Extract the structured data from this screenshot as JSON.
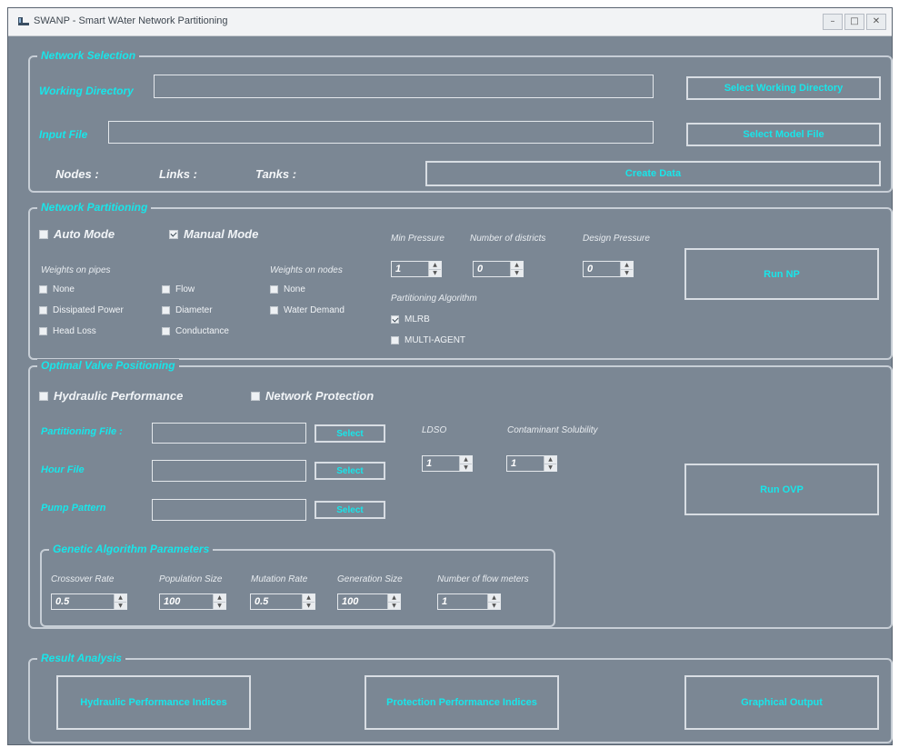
{
  "window": {
    "title": "SWANP - Smart WAter Network Partitioning",
    "controls": [
      "–",
      "□",
      "✕"
    ]
  },
  "network_selection": {
    "legend": "Network Selection",
    "working_dir_label": "Working Directory",
    "working_dir_value": "",
    "input_file_label": "Input File",
    "input_file_value": "",
    "select_working_dir_button": "Select Working Directory",
    "select_model_file_button": "Select Model File",
    "nodes_label": "Nodes :",
    "links_label": "Links :",
    "tanks_label": "Tanks :",
    "create_data_button": "Create Data"
  },
  "network_partitioning": {
    "legend": "Network Partitioning",
    "auto_mode": {
      "label": "Auto Mode",
      "checked": false
    },
    "manual_mode": {
      "label": "Manual Mode",
      "checked": true
    },
    "weights_on_pipes_label": "Weights on pipes",
    "pipe_weights": [
      {
        "label": "None",
        "checked": false
      },
      {
        "label": "Flow",
        "checked": false
      },
      {
        "label": "Dissipated Power",
        "checked": false
      },
      {
        "label": "Diameter",
        "checked": false
      },
      {
        "label": "Head Loss",
        "checked": false
      },
      {
        "label": "Conductance",
        "checked": false
      }
    ],
    "weights_on_nodes_label": "Weights on nodes",
    "node_weights": [
      {
        "label": "None",
        "checked": false
      },
      {
        "label": "Water Demand",
        "checked": false
      }
    ],
    "min_pressure_label": "Min Pressure",
    "min_pressure_value": "1",
    "num_districts_label": "Number of districts",
    "num_districts_value": "0",
    "design_pressure_label": "Design Pressure",
    "design_pressure_value": "0",
    "algorithm_label": "Partitioning Algorithm",
    "algorithms": [
      {
        "label": "MLRB",
        "checked": true
      },
      {
        "label": "MULTI-AGENT",
        "checked": false
      }
    ],
    "run_button": "Run NP"
  },
  "valve_positioning": {
    "legend": "Optimal Valve Positioning",
    "hydraulic_performance": {
      "label": "Hydraulic Performance",
      "checked": false
    },
    "network_protection": {
      "label": "Network Protection",
      "checked": false
    },
    "partitioning_file_label": "Partitioning File :",
    "partitioning_file_value": "",
    "hour_file_label": "Hour File",
    "hour_file_value": "",
    "pump_pattern_label": "Pump Pattern",
    "pump_pattern_value": "",
    "select_button": "Select",
    "ldso_label": "LDSO",
    "ldso_value": "1",
    "contaminant_label": "Contaminant Solubility",
    "contaminant_value": "1",
    "run_button": "Run OVP"
  },
  "genetic": {
    "legend": "Genetic Algorithm Parameters",
    "params": [
      {
        "label": "Crossover Rate",
        "value": "0.5"
      },
      {
        "label": "Population Size",
        "value": "100"
      },
      {
        "label": "Mutation Rate",
        "value": "0.5"
      },
      {
        "label": "Generation Size",
        "value": "100"
      },
      {
        "label": "Number of flow meters",
        "value": "1"
      }
    ]
  },
  "result_analysis": {
    "legend": "Result Analysis",
    "hydraulic_button": "Hydraulic Performance Indices",
    "protection_button": "Protection Performance Indices",
    "graphical_button": "Graphical Output"
  },
  "colors": {
    "background": "#7b8794",
    "accent": "#18e6ea",
    "border": "#c7ced6"
  }
}
